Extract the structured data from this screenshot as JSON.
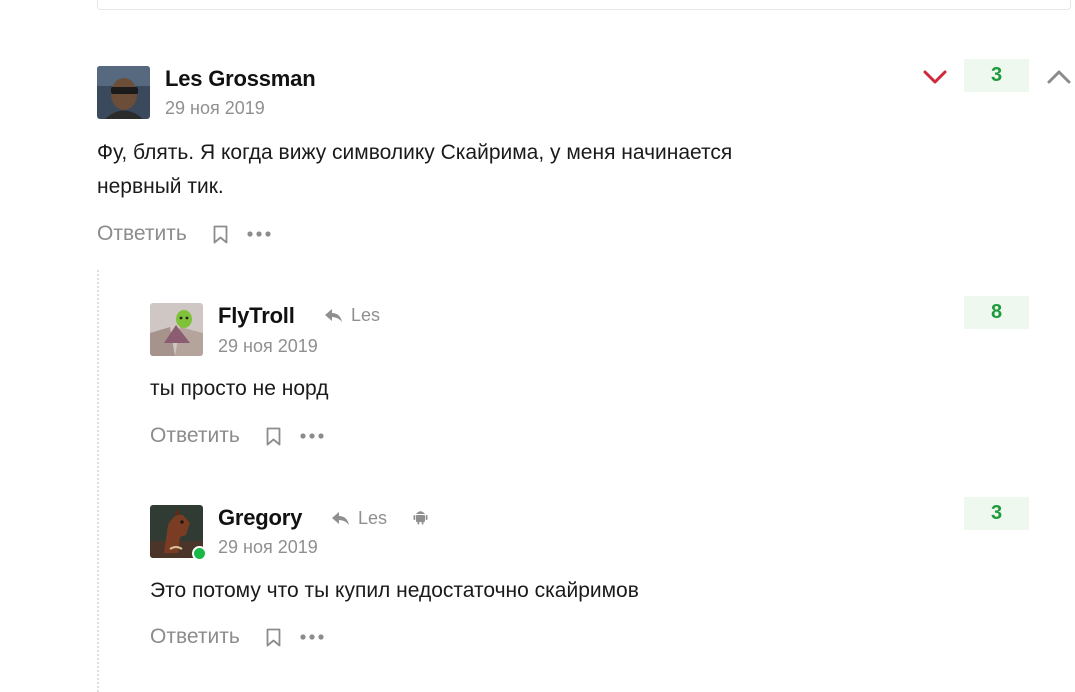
{
  "colors": {
    "score_bg": "#eef8ef",
    "score_text": "#1d9a3c",
    "downvote": "#d0273a",
    "muted": "#8f8f8f",
    "online": "#19b94a"
  },
  "comments": [
    {
      "author": "Les Grossman",
      "date": "29 ноя 2019",
      "text_lines": [
        "Фу, блять. Я когда вижу символику Скайрима, у меня начинается",
        "нервный тик."
      ],
      "score": "3",
      "reply_label": "Ответить",
      "avatar_icon": "user-avatar",
      "vote_icons": [
        "chevron-down-icon",
        "chevron-up-icon"
      ]
    },
    {
      "author": "FlyTroll",
      "reply_to": "Les",
      "date": "29 ноя 2019",
      "text_lines": [
        "ты просто не норд"
      ],
      "score": "8",
      "reply_label": "Ответить",
      "avatar_icon": "user-avatar"
    },
    {
      "author": "Gregory",
      "reply_to": "Les",
      "date": "29 ноя 2019",
      "text_lines": [
        "Это потому что ты купил недостаточно скайримов"
      ],
      "score": "3",
      "reply_label": "Ответить",
      "avatar_icon": "user-avatar",
      "device_icon": "android-icon",
      "online": true
    }
  ]
}
